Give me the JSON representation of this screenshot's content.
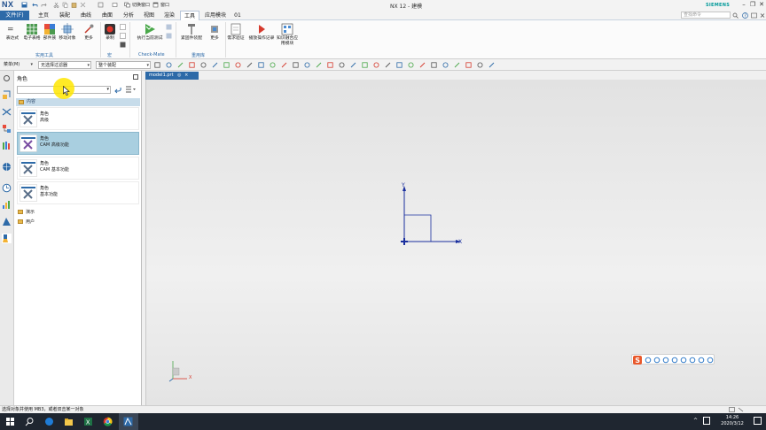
{
  "app": {
    "logo": "NX",
    "window_title": "NX 12 - 建模",
    "brand": "SIEMENS",
    "search_placeholder": "查找命令",
    "quick_access": {
      "window_menu": "切换窗口",
      "window_label": "窗口"
    }
  },
  "tabs": [
    {
      "label": "文件(F)"
    },
    {
      "label": "主页"
    },
    {
      "label": "装配"
    },
    {
      "label": "曲线"
    },
    {
      "label": "曲面"
    },
    {
      "label": "分析"
    },
    {
      "label": "视图"
    },
    {
      "label": "渲染"
    },
    {
      "label": "工具"
    },
    {
      "label": "应用模块"
    },
    {
      "label": "01"
    }
  ],
  "ribbon": {
    "buttons": [
      {
        "label": "表达式"
      },
      {
        "label": "电子表格"
      },
      {
        "label": "部件族"
      },
      {
        "label": "移动对象"
      },
      {
        "label": "更多"
      },
      {
        "label": "录制"
      },
      {
        "label": "执行当前测试"
      },
      {
        "label": "紧固件装配"
      },
      {
        "label": "更多"
      },
      {
        "label": "需求验证"
      },
      {
        "label": "播放操作记录"
      },
      {
        "label": "知识融合应用模块"
      }
    ],
    "groups": [
      {
        "label": "实用工具"
      },
      {
        "label": "宏"
      },
      {
        "label": "Check-Mate"
      },
      {
        "label": "重用库"
      }
    ]
  },
  "selection_bar": {
    "menu": "菜单(M)",
    "filter": "无选择过滤器",
    "scope": "整个装配"
  },
  "panel": {
    "title": "角色",
    "section_content": "内容",
    "roles": [
      {
        "t1": "角色",
        "t2": "高级",
        "selected": false
      },
      {
        "t1": "角色",
        "t2": "CAM 高级功能",
        "selected": true
      },
      {
        "t1": "角色",
        "t2": "CAM 基本功能",
        "selected": false
      },
      {
        "t1": "角色",
        "t2": "基本功能",
        "selected": false
      }
    ],
    "folders": [
      {
        "label": "演示"
      },
      {
        "label": "用户"
      }
    ]
  },
  "document": {
    "tab_label": "model1.prt",
    "modified": "◎",
    "close": "×"
  },
  "viewport": {
    "csys_x": "X",
    "csys_y": "Y",
    "triad_x": "X"
  },
  "status": {
    "message": "选择对象并使用 MB3，或者双击某一对象"
  },
  "taskbar": {
    "time": "14:26",
    "date": "2020/3/12"
  },
  "colors": {
    "accent": "#2d6aa8",
    "selected_row": "#a9cfe0",
    "section_header": "#c7dcea",
    "csys": "#1a2f9e",
    "brand": "#009999"
  }
}
